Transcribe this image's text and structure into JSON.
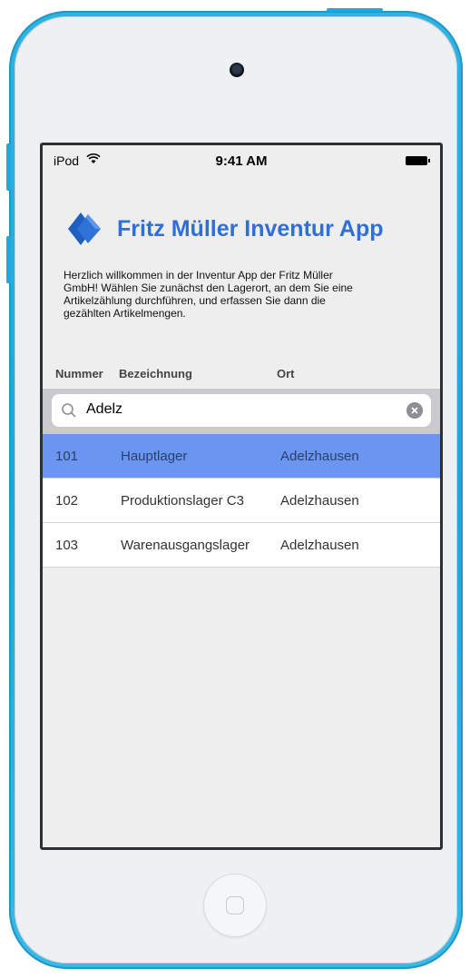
{
  "status": {
    "carrier": "iPod",
    "time": "9:41 AM"
  },
  "header": {
    "title": "Fritz Müller Inventur App"
  },
  "intro": "Herzlich willkommen in der Inventur App der Fritz Müller GmbH! Wählen Sie zunächst den Lagerort, an dem Sie eine Artikelzählung durchführen, und erfassen Sie dann die gezählten Artikelmengen.",
  "columns": {
    "number": "Nummer",
    "name": "Bezeichnung",
    "location": "Ort"
  },
  "search": {
    "value": "Adelz"
  },
  "rows": [
    {
      "number": "101",
      "name": "Hauptlager",
      "location": "Adelzhausen",
      "selected": true
    },
    {
      "number": "102",
      "name": "Produktionslager C3",
      "location": "Adelzhausen",
      "selected": false
    },
    {
      "number": "103",
      "name": "Warenausgangslager",
      "location": "Adelzhausen",
      "selected": false
    }
  ],
  "colors": {
    "brand": "#2f6fd6",
    "selected_row": "#6b96f0",
    "device": "#1da7db"
  },
  "icons": [
    "wifi-icon",
    "battery-icon",
    "app-logo",
    "search-icon",
    "clear-icon",
    "home-button"
  ]
}
